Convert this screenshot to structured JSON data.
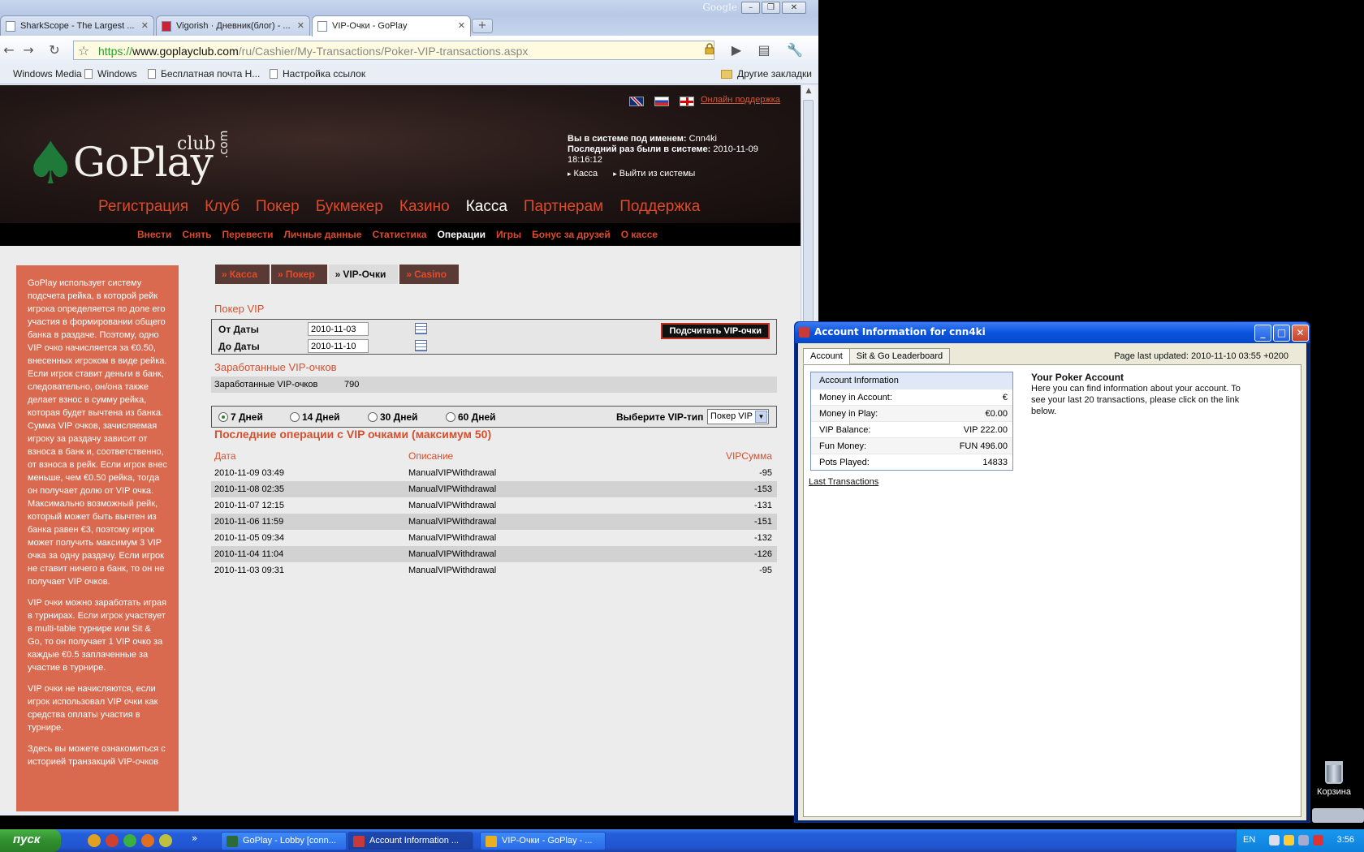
{
  "browser": {
    "google_mark": "Google",
    "tabs": [
      {
        "title": "SharkScope - The Largest ..."
      },
      {
        "title": "Vigorish · Дневник(блог) - ..."
      },
      {
        "title": "VIP-Очки - GoPlay"
      }
    ],
    "url": {
      "protocol": "https://",
      "host": "www.goplayclub.com",
      "path": "/ru/Cashier/My-Transactions/Poker-VIP-transactions.aspx"
    },
    "bookmarks": [
      "Windows Media",
      "Windows",
      "Бесплатная почта Н...",
      "Настройка ссылок"
    ],
    "other_bookmarks": "Другие закладки"
  },
  "site": {
    "support_link": "Онлайн поддержка",
    "logo": {
      "word": "GoPlay",
      "club": "club",
      "com": ".com"
    },
    "user": {
      "logged_as_label": "Вы в системе под именем:",
      "username": "Cnn4ki",
      "last_login_label": "Последний раз были в системе:",
      "last_login": "2010-11-09 18:16:12",
      "links": [
        "Касса",
        "Выйти из системы"
      ]
    },
    "main_nav": [
      {
        "label": "Регистрация",
        "active": false
      },
      {
        "label": "Клуб",
        "active": false
      },
      {
        "label": "Покер",
        "active": false
      },
      {
        "label": "Букмекер",
        "active": false
      },
      {
        "label": "Казино",
        "active": false
      },
      {
        "label": "Касса",
        "active": true
      },
      {
        "label": "Партнерам",
        "active": false
      },
      {
        "label": "Поддержка",
        "active": false
      }
    ],
    "sub_nav": [
      {
        "label": "Внести",
        "active": false
      },
      {
        "label": "Снять",
        "active": false
      },
      {
        "label": "Перевести",
        "active": false
      },
      {
        "label": "Личные данные",
        "active": false
      },
      {
        "label": "Статистика",
        "active": false
      },
      {
        "label": "Операции",
        "active": true
      },
      {
        "label": "Игры",
        "active": false
      },
      {
        "label": "Бонус за друзей",
        "active": false
      },
      {
        "label": "О кассе",
        "active": false
      }
    ],
    "sidebar_paragraphs": [
      "GoPlay использует систему подсчета рейка, в которой рейк игрока определяется по доле его участия в формировании общего банка в раздаче. Поэтому, одно VIP очко начисляется за €0.50, внесенных игроком в виде рейка. Если игрок ставит деньги в банк, следовательно, он/она также делает взнос в сумму рейка, которая будет вычтена из банка. Сумма VIP очков, зачисляемая игроку за раздачу зависит от взноса в банк и, соответственно, от взноса в рейк. Если игрок внес меньше, чем €0.50 рейка, тогда он получает долю от VIP очка. Максимально возможный рейк, который может быть вычтен из банка равен €3, поэтому игрок может получить максимум 3 VIP очка за одну раздачу. Если игрок не ставит ничего в банк, то он не получает VIP очков.",
      "VIP очки можно заработать играя в турнирах. Если игрок участвует в multi-table турнире или Sit & Go, то он получает 1 VIP очко за каждые €0.5 заплаченные за участие в турнире.",
      "VIP очки не начисляются, если игрок использовал VIP очки как средства оплаты участия в турнире.",
      "Здесь вы можете ознакомиться с историей транзакций VIP-очков"
    ],
    "section_tabs": [
      {
        "label": "Касса",
        "active": false
      },
      {
        "label": "Покер",
        "active": false
      },
      {
        "label": "VIP-Очки",
        "active": true
      },
      {
        "label": "Casino",
        "active": false
      }
    ],
    "poker_vip_heading": "Покер VIP",
    "date_from_label": "От Даты",
    "date_from": "2010-11-03",
    "date_to_label": "До Даты",
    "date_to": "2010-11-10",
    "calc_button": "Подсчитать VIP-очки",
    "earned_heading": "Заработанные VIP-очков",
    "earned_label": "Заработанные VIP-очков",
    "earned_value": "790",
    "periods": [
      {
        "label": "7 Дней",
        "checked": true
      },
      {
        "label": "14 Дней",
        "checked": false
      },
      {
        "label": "30 Дней",
        "checked": false
      },
      {
        "label": "60 Дней",
        "checked": false
      }
    ],
    "viptype_label": "Выберите VIP-тип",
    "viptype_value": "Покер VIP",
    "ops_heading": "Последние операции с VIP очками (максимум 50)",
    "ops_columns": [
      "Дата",
      "Описание",
      "VIPСумма"
    ],
    "ops_rows": [
      {
        "date": "2010-11-09 03:49",
        "desc": "ManualVIPWithdrawal",
        "amount": "-95"
      },
      {
        "date": "2010-11-08 02:35",
        "desc": "ManualVIPWithdrawal",
        "amount": "-153"
      },
      {
        "date": "2010-11-07 12:15",
        "desc": "ManualVIPWithdrawal",
        "amount": "-131"
      },
      {
        "date": "2010-11-06 11:59",
        "desc": "ManualVIPWithdrawal",
        "amount": "-151"
      },
      {
        "date": "2010-11-05 09:34",
        "desc": "ManualVIPWithdrawal",
        "amount": "-132"
      },
      {
        "date": "2010-11-04 11:04",
        "desc": "ManualVIPWithdrawal",
        "amount": "-126"
      },
      {
        "date": "2010-11-03 09:31",
        "desc": "ManualVIPWithdrawal",
        "amount": "-95"
      }
    ]
  },
  "account_window": {
    "title": "Account Information for cnn4ki",
    "tabs": [
      {
        "label": "Account",
        "active": true
      },
      {
        "label": "Sit & Go Leaderboard",
        "active": false
      }
    ],
    "updated": "Page last updated: 2010-11-10 03:55 +0200",
    "info_heading": "Account Information",
    "info_rows": [
      {
        "k": "Money in Account:",
        "v": "€"
      },
      {
        "k": "Money in Play:",
        "v": "€0.00"
      },
      {
        "k": "VIP Balance:",
        "v": "VIP 222.00"
      },
      {
        "k": "Fun Money:",
        "v": "FUN 496.00"
      },
      {
        "k": "Pots Played:",
        "v": "14833"
      }
    ],
    "last_transactions": "Last Transactions",
    "desc_title": "Your Poker Account",
    "desc_text": "Here you can find information about your account. To see your last 20 transactions, please click on the link below."
  },
  "desktop": {
    "trash_label": "Корзина",
    "start_label": "пуск",
    "tasks": [
      {
        "label": "GoPlay - Lobby [conn...",
        "active": false,
        "color": "#2d6a3a"
      },
      {
        "label": "Account Information ...",
        "active": true,
        "color": "#c83a3a"
      },
      {
        "label": "VIP-Очки - GoPlay - ...",
        "active": false,
        "color": "#e8b020"
      }
    ],
    "lang": "EN",
    "clock": "3:56"
  }
}
